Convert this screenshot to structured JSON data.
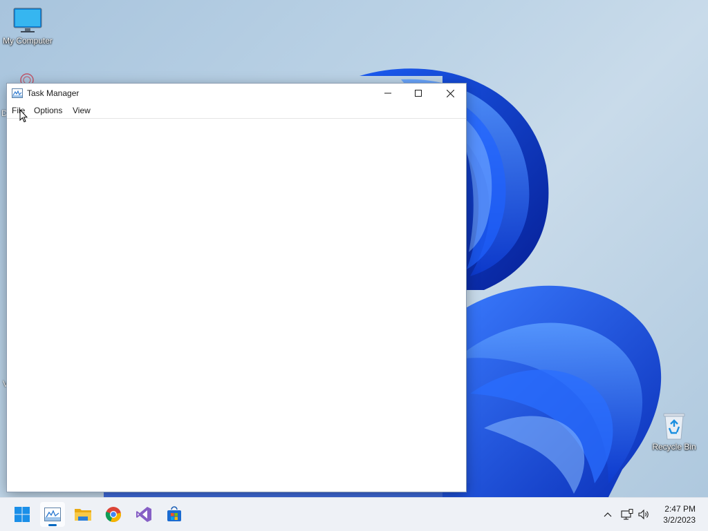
{
  "desktop": {
    "icons": [
      {
        "label": "My Computer",
        "icon": "monitor-icon"
      },
      {
        "label": "Recycle Bin",
        "icon": "recycle-bin-icon"
      }
    ],
    "partial_icon_letters": [
      "D",
      "V"
    ]
  },
  "window": {
    "title": "Task Manager",
    "icon": "task-manager-icon",
    "controls": {
      "minimize": "minimize-icon",
      "maximize": "maximize-icon",
      "close": "close-icon"
    },
    "menu": [
      "File",
      "Options",
      "View"
    ]
  },
  "taskbar": {
    "apps": [
      {
        "name": "Start",
        "icon": "windows-start-icon"
      },
      {
        "name": "Task Manager",
        "icon": "task-manager-icon",
        "active": true
      },
      {
        "name": "File Explorer",
        "icon": "folder-icon"
      },
      {
        "name": "Google Chrome",
        "icon": "chrome-icon"
      },
      {
        "name": "Visual Studio",
        "icon": "visual-studio-icon"
      },
      {
        "name": "Microsoft Store",
        "icon": "store-icon"
      }
    ],
    "tray_icons": [
      "chevron-up-icon",
      "network-icon",
      "volume-icon"
    ],
    "clock": {
      "time": "2:47 PM",
      "date": "3/2/2023"
    }
  },
  "colors": {
    "accent": "#0067c0",
    "bloom": "#0a3fd8",
    "taskbar": "#eef1f6"
  }
}
